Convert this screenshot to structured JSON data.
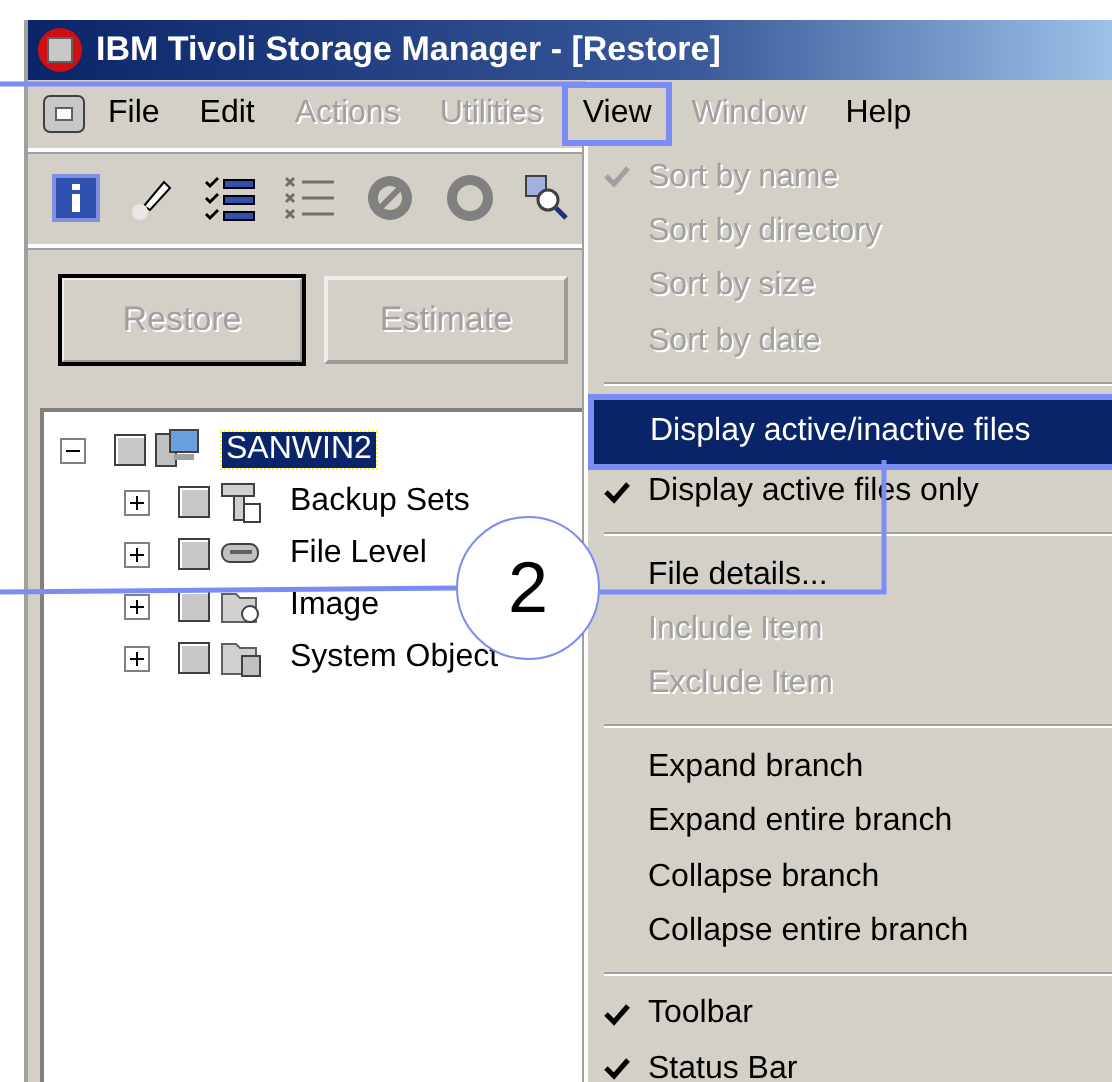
{
  "window": {
    "title": "IBM Tivoli Storage Manager - [Restore]"
  },
  "menu_bar": [
    {
      "label": "File",
      "disabled": false,
      "selected": false
    },
    {
      "label": "Edit",
      "disabled": false,
      "selected": false
    },
    {
      "label": "Actions",
      "disabled": true,
      "selected": false
    },
    {
      "label": "Utilities",
      "disabled": true,
      "selected": false
    },
    {
      "label": "View",
      "disabled": false,
      "selected": true
    },
    {
      "label": "Window",
      "disabled": true,
      "selected": false
    },
    {
      "label": "Help",
      "disabled": false,
      "selected": false
    }
  ],
  "buttons": [
    {
      "label": "Restore",
      "disabled": true,
      "default": true
    },
    {
      "label": "Estimate",
      "disabled": true,
      "default": false
    }
  ],
  "tree": [
    {
      "label": "SANWIN2",
      "selected": true,
      "expanded": true,
      "checked": false,
      "children": [
        {
          "label": "Backup Sets",
          "selected": false,
          "expanded": false,
          "checked": false
        },
        {
          "label": "File Level",
          "selected": false,
          "expanded": false,
          "checked": false
        },
        {
          "label": "Image",
          "selected": false,
          "expanded": false,
          "checked": false
        },
        {
          "label": "System Object",
          "selected": false,
          "expanded": false,
          "checked": false
        }
      ]
    }
  ],
  "view_menu": [
    {
      "kind": "item",
      "label": "Sort by name",
      "checked": true,
      "disabled": true,
      "selected": false
    },
    {
      "kind": "item",
      "label": "Sort by directory",
      "checked": false,
      "disabled": true,
      "selected": false
    },
    {
      "kind": "item",
      "label": "Sort by size",
      "checked": false,
      "disabled": true,
      "selected": false
    },
    {
      "kind": "item",
      "label": "Sort by date",
      "checked": false,
      "disabled": true,
      "selected": false
    },
    {
      "kind": "separator"
    },
    {
      "kind": "item",
      "label": "Display active/inactive files",
      "checked": false,
      "disabled": false,
      "selected": true
    },
    {
      "kind": "item",
      "label": "Display active files only",
      "checked": true,
      "disabled": false,
      "selected": false
    },
    {
      "kind": "separator"
    },
    {
      "kind": "item",
      "label": "File details...",
      "checked": false,
      "disabled": false,
      "selected": false
    },
    {
      "kind": "item",
      "label": "Include Item",
      "checked": false,
      "disabled": true,
      "selected": false
    },
    {
      "kind": "item",
      "label": "Exclude Item",
      "checked": false,
      "disabled": true,
      "selected": false
    },
    {
      "kind": "separator"
    },
    {
      "kind": "item",
      "label": "Expand branch",
      "checked": false,
      "disabled": false,
      "selected": false
    },
    {
      "kind": "item",
      "label": "Expand entire branch",
      "checked": false,
      "disabled": false,
      "selected": false
    },
    {
      "kind": "item",
      "label": "Collapse branch",
      "checked": false,
      "disabled": false,
      "selected": false
    },
    {
      "kind": "item",
      "label": "Collapse entire branch",
      "checked": false,
      "disabled": false,
      "selected": false
    },
    {
      "kind": "separator"
    },
    {
      "kind": "item",
      "label": "Toolbar",
      "checked": true,
      "disabled": false,
      "selected": false
    },
    {
      "kind": "item",
      "label": "Status Bar",
      "checked": true,
      "disabled": false,
      "selected": false
    }
  ],
  "callout": {
    "number": "2"
  }
}
